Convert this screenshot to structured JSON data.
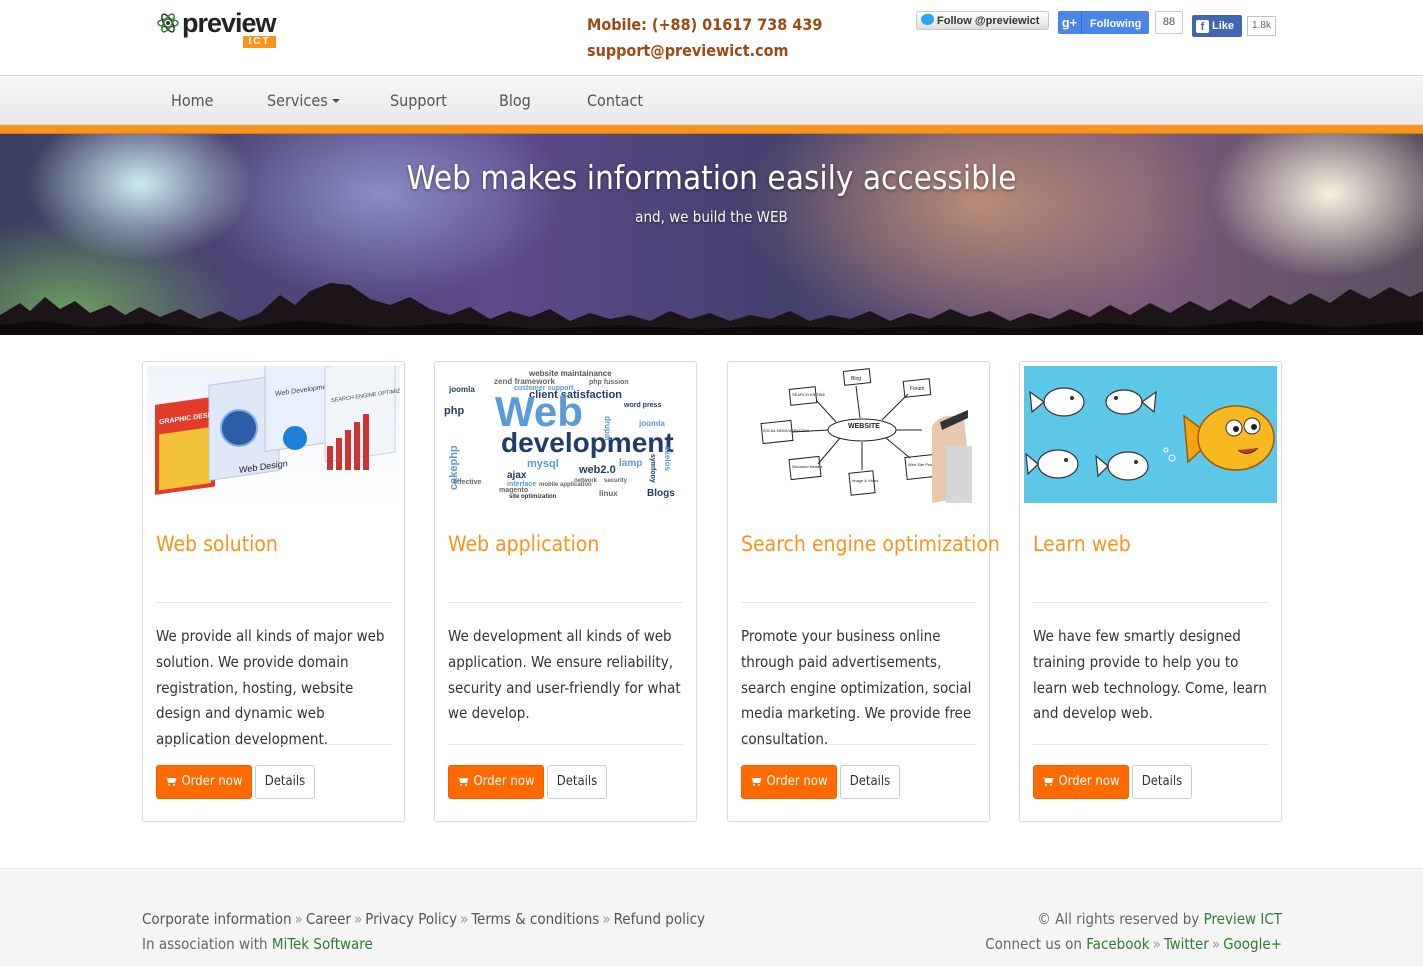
{
  "header": {
    "logo_text": "preview",
    "logo_badge": "ICT",
    "mobile": "Mobile: (+88) 01617 738 439",
    "email": "support@previewict.com",
    "twitter_label": "Follow @previewict",
    "gplus_label": "Following",
    "gplus_count": "88",
    "fb_label": "Like",
    "fb_count": "1.8k"
  },
  "nav": {
    "items": [
      {
        "label": "Home"
      },
      {
        "label": "Services"
      },
      {
        "label": "Support"
      },
      {
        "label": "Blog"
      },
      {
        "label": "Contact"
      }
    ]
  },
  "hero": {
    "title": "Web makes information easily accessible",
    "subtitle": "and, we build the WEB"
  },
  "cards": [
    {
      "title": "Web solution",
      "text": "We provide all kinds of major web solution. We provide domain registration, hosting, website design and dynamic web application development.",
      "order_label": "Order now",
      "details_label": "Details"
    },
    {
      "title": "Web application",
      "text": "We development all kinds of web application. We ensure reliability, security and user-friendly for what we develop.",
      "order_label": "Order now",
      "details_label": "Details"
    },
    {
      "title": "Search engine optimization",
      "text": "Promote your business online through paid advertisements, search engine optimization, social media marketing. We provide free consultation.",
      "order_label": "Order now",
      "details_label": "Details"
    },
    {
      "title": "Learn web",
      "text": "We have few smartly designed training provide to help you to learn web technology. Come, learn and develop web.",
      "order_label": "Order now",
      "details_label": "Details"
    }
  ],
  "card_images": {
    "c1": {
      "labels": [
        "GRAPHIC DESIGN!",
        "Web Design",
        "Web Development!",
        "SEARCH ENGINE OPTIMIZATION!"
      ]
    },
    "c2": {
      "big1": "Web",
      "big2": "development",
      "words": [
        "website maintainance",
        "zend framework",
        "joomla",
        "php fussion",
        "customer support",
        "client satisfaction",
        "php",
        "word press",
        "ajax",
        "mysql",
        "web2.0",
        "cakephp",
        "magento",
        "linux",
        "Blogs",
        "joomla",
        "drupal",
        "akelos",
        "symfony",
        "lamp",
        "effective",
        "interface",
        "mobile application",
        "site optimization",
        "network",
        "security"
      ]
    },
    "c3": {
      "center": "WEBSITE",
      "nodes": [
        "Blog",
        "Forum",
        "SEARCH ENGINE",
        "SOCIAL MEDIA MARKETING",
        "Discussion Markets",
        "Image & Video",
        "Web Site Promotion"
      ]
    }
  },
  "footer": {
    "links": [
      "Corporate information",
      "Career",
      "Privacy Policy",
      "Terms & conditions",
      "Refund policy"
    ],
    "sep": "»",
    "assoc_prefix": "In association with",
    "assoc_link": "MiTek Software",
    "rights_prefix": "© All rights reserved by",
    "rights_link": "Preview ICT",
    "connect_prefix": "Connect us on",
    "social_links": [
      "Facebook",
      "Twitter",
      "Google+"
    ]
  },
  "colors": {
    "accent": "#f7941d",
    "order_button": "#ff6a00",
    "contact_text": "#9c4a12",
    "footer_link": "#2e7d32"
  }
}
